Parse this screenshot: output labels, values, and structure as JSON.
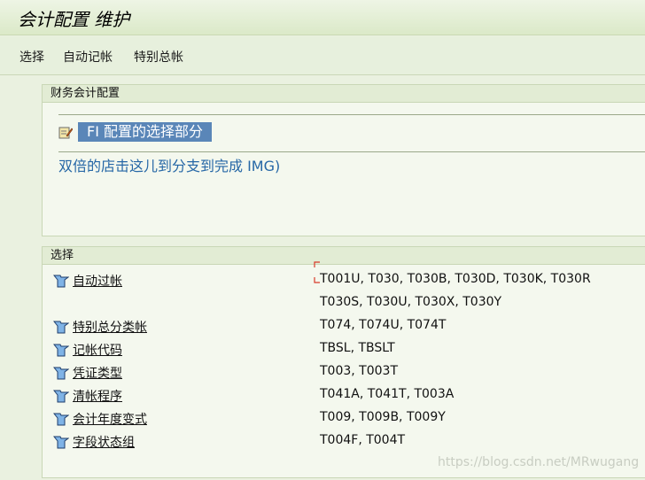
{
  "window": {
    "title": "会计配置 维护"
  },
  "menubar": {
    "items": [
      "选择",
      "自动记帐",
      "特别总帐"
    ]
  },
  "panel1": {
    "header": "财务会计配置",
    "fi_label": "FI 配置的选择部分",
    "link_text": "双倍的店击这儿到分支到完成 IMG)"
  },
  "panel2": {
    "header": "选择",
    "rows": [
      {
        "label": "自动过帐",
        "tables": [
          "T001U, T030,  T030B, T030D, T030K, T030R",
          "T030S, T030U, T030X, T030Y"
        ]
      },
      {
        "label": "特别总分类帐",
        "tables": [
          "T074,  T074U, T074T"
        ]
      },
      {
        "label": "记帐代码",
        "tables": [
          "TBSL,  TBSLT"
        ]
      },
      {
        "label": "凭证类型",
        "tables": [
          "T003,  T003T"
        ]
      },
      {
        "label": "清帐程序",
        "tables": [
          "T041A,  T041T, T003A"
        ]
      },
      {
        "label": "会计年度变式",
        "tables": [
          "T009,  T009B, T009Y"
        ]
      },
      {
        "label": "字段状态组",
        "tables": [
          "T004F, T004T"
        ]
      }
    ]
  },
  "watermark": "https://blog.csdn.net/MRwugang",
  "colors": {
    "accent": "#5a86b8",
    "link": "#2667a6",
    "bg": "#eaf1e0"
  },
  "icons": {
    "fi": "pencil-note-icon",
    "node": "folder-node-icon"
  }
}
